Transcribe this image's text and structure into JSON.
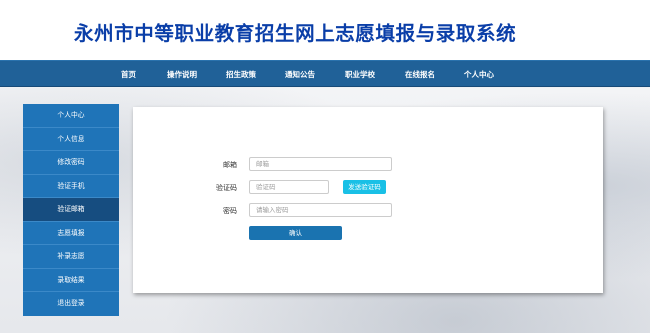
{
  "site": {
    "title": "永州市中等职业教育招生网上志愿填报与录取系统"
  },
  "nav": {
    "items": [
      "首页",
      "操作说明",
      "招生政策",
      "通知公告",
      "职业学校",
      "在线报名",
      "个人中心"
    ]
  },
  "sidebar": {
    "items": [
      "个人中心",
      "个人信息",
      "修改密码",
      "验证手机",
      "验证邮箱",
      "志愿填报",
      "补录志愿",
      "录取结果",
      "退出登录"
    ],
    "active": "验证邮箱"
  },
  "form": {
    "email_label": "邮箱",
    "email_placeholder": "邮箱",
    "code_label": "验证码",
    "code_placeholder": "验证码",
    "send_code_label": "发送验证码",
    "password_label": "密码",
    "password_placeholder": "请输入密码",
    "submit_label": "确认"
  },
  "colors": {
    "title": "#0a3ea8",
    "navbar": "#206198",
    "sidebar": "#1f74b8",
    "sidebar_active": "#164d80",
    "send_code_button": "#19c0e6",
    "submit_button": "#1a73b0"
  }
}
